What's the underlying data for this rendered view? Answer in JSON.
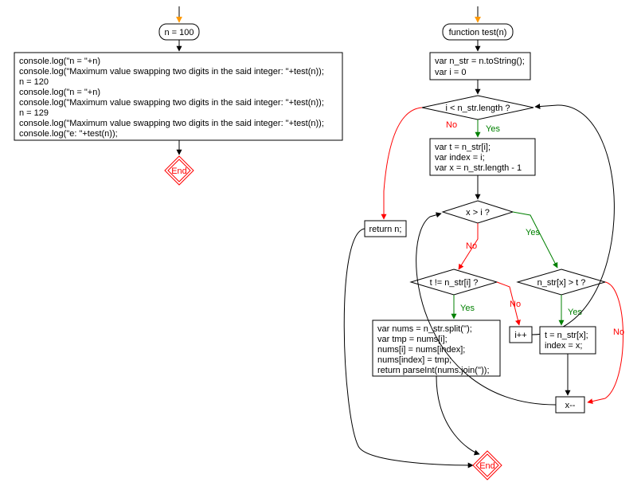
{
  "left": {
    "start": "n = 100",
    "code": [
      "console.log(\"n = \"+n)",
      "console.log(\"Maximum value swapping two digits in the said integer: \"+test(n));",
      "n = 120",
      "console.log(\"n = \"+n)",
      "console.log(\"Maximum value swapping two digits in the said integer: \"+test(n));",
      "n = 129",
      "console.log(\"Maximum value swapping two digits in the said integer: \"+test(n));",
      "console.log(\"e: \"+test(n));"
    ],
    "end": "End"
  },
  "right": {
    "fn": "function test(n)",
    "init": [
      "var n_str = n.toString();",
      "var i = 0"
    ],
    "cond1": "i < n_str.length ?",
    "block1": [
      "var t = n_str[i];",
      "var index = i;",
      "var x = n_str.length - 1"
    ],
    "ret_n": "return n;",
    "cond2": "x > i ?",
    "cond3": "t != n_str[i] ?",
    "cond4": "n_str[x] > t ?",
    "block2": [
      "var nums = n_str.split('');",
      "var tmp = nums[i];",
      "nums[i] = nums[index];",
      "nums[index] = tmp;",
      "return parseInt(nums.join(''));"
    ],
    "inc_i": "i++",
    "upd": [
      "t = n_str[x];",
      "index = x;"
    ],
    "dec_x": "x--",
    "end": "End",
    "yes": "Yes",
    "no": "No"
  }
}
